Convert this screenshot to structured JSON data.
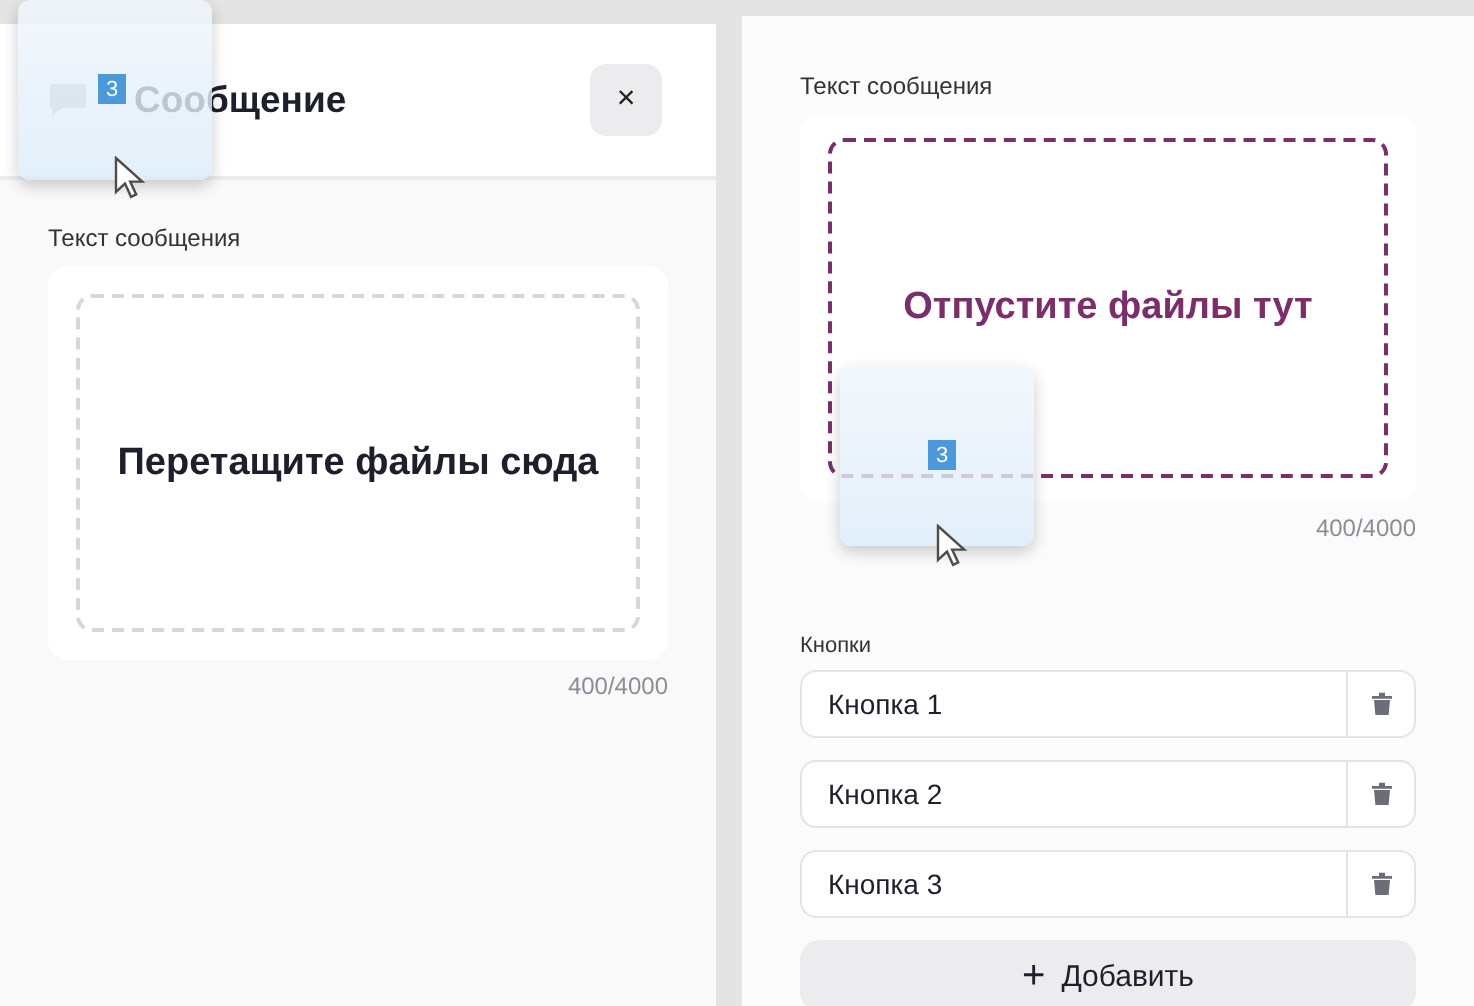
{
  "panels": [
    {
      "kind": "modal",
      "title": "Сообщение",
      "close": "×",
      "field_label": "Текст сообщения",
      "dropzone": {
        "active": false,
        "text": "Перетащите файлы сюда"
      },
      "counter": "400/4000"
    },
    {
      "kind": "editor",
      "field_label": "Текст сообщения",
      "dropzone": {
        "active": true,
        "text": "Отпустите файлы тут"
      },
      "counter": "400/4000",
      "buttons_label": "Кнопки",
      "buttons": [
        {
          "value": "Кнопка 1"
        },
        {
          "value": "Кнопка 2"
        },
        {
          "value": "Кнопка 3"
        }
      ],
      "add_button": {
        "icon": "+",
        "label": "Добавить"
      }
    }
  ],
  "drag_ghosts": [
    {
      "badge": "3"
    },
    {
      "badge": "3"
    }
  ]
}
